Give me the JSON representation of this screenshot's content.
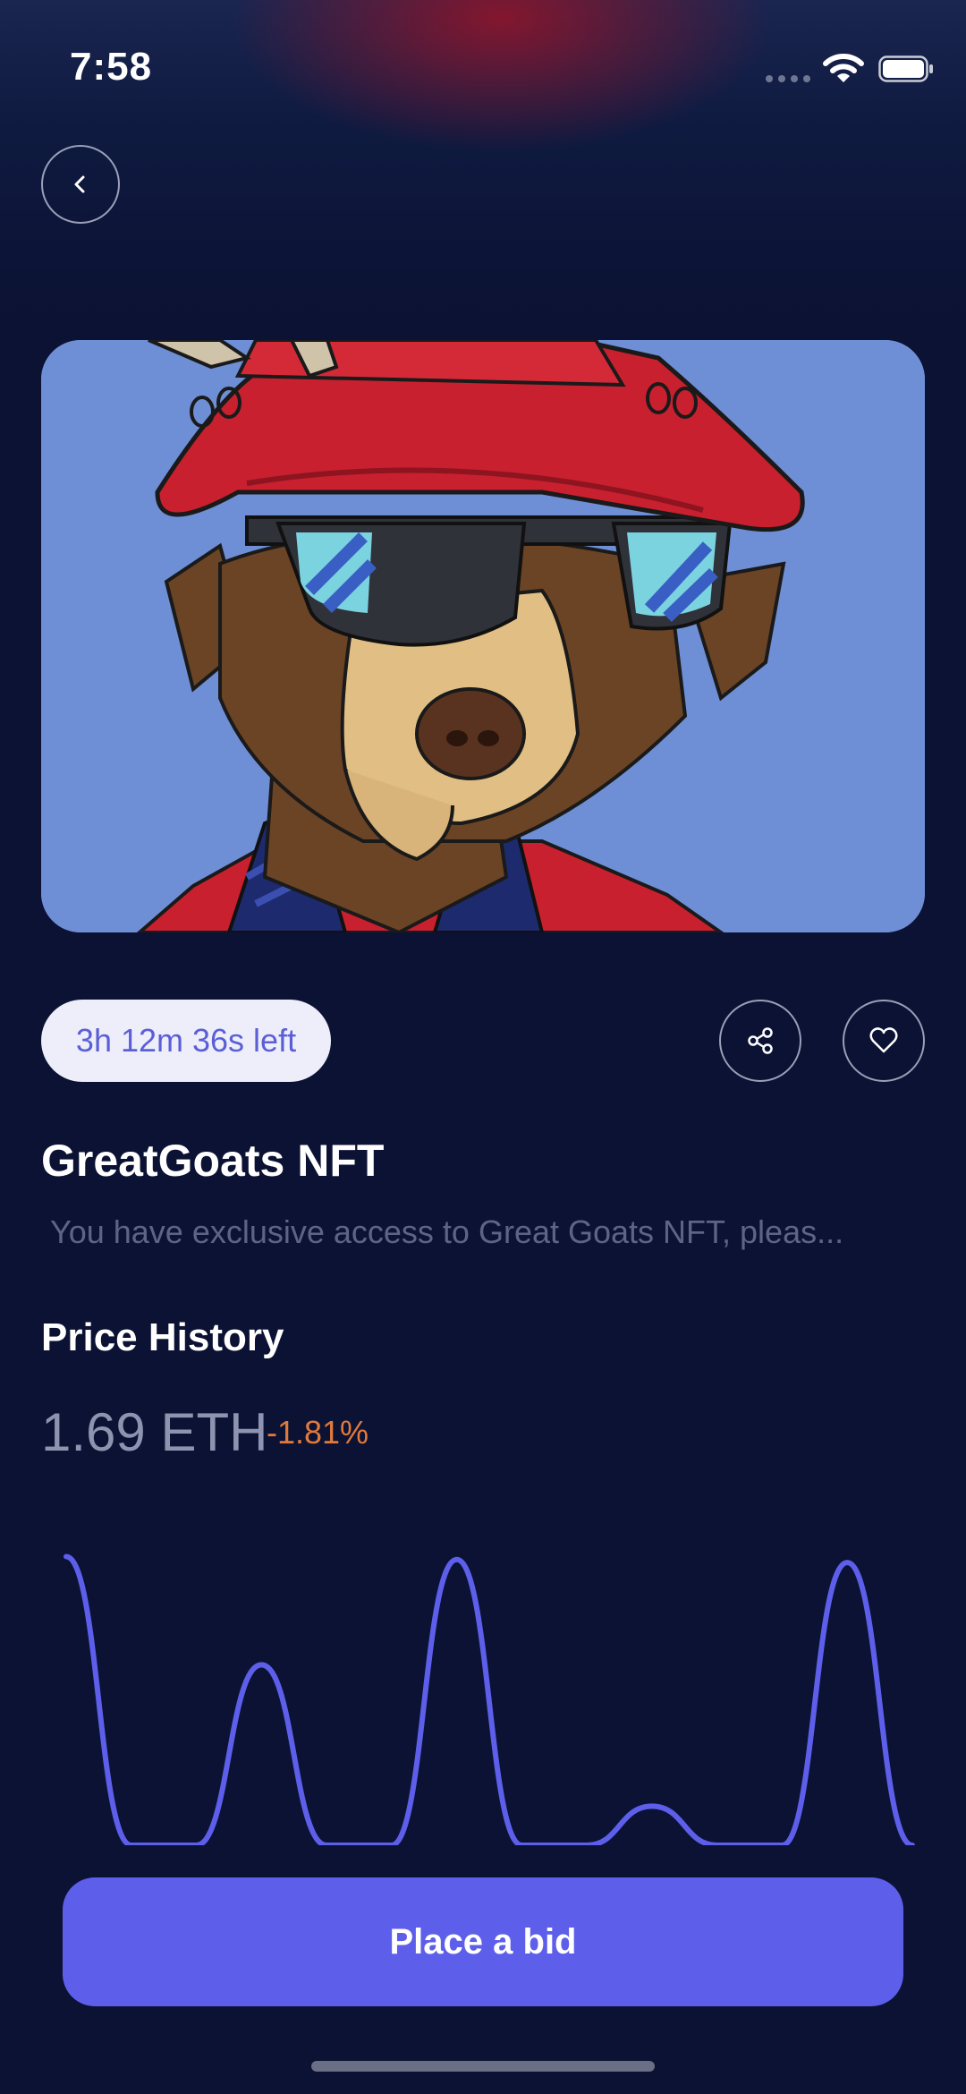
{
  "status_bar": {
    "time": "7:58"
  },
  "navigation": {
    "back_icon": "chevron-left-icon"
  },
  "hero": {
    "image_subject": "cartoon goat wearing red bucket hat and sunglasses"
  },
  "auction": {
    "time_left": "3h 12m 36s left"
  },
  "actions": {
    "share_icon": "share-icon",
    "like_icon": "heart-icon"
  },
  "nft": {
    "title": "GreatGoats NFT",
    "description": "You have exclusive access to Great Goats NFT, pleas..."
  },
  "price_history": {
    "heading": "Price History",
    "price": "1.69 ETH",
    "change": "-1.81%",
    "change_color": "#e07a3c",
    "line_color": "#5d5feb"
  },
  "chart_data": {
    "type": "line",
    "title": "",
    "xlabel": "",
    "ylabel": "",
    "series": [
      {
        "values": [
          0.96,
          0.0,
          0.0,
          0.6,
          0.0,
          0.0,
          0.95,
          0.0,
          0.0,
          0.13,
          0.0,
          0.0,
          0.94,
          0.0
        ]
      }
    ]
  },
  "footer": {
    "bid_label": "Place a bid"
  }
}
